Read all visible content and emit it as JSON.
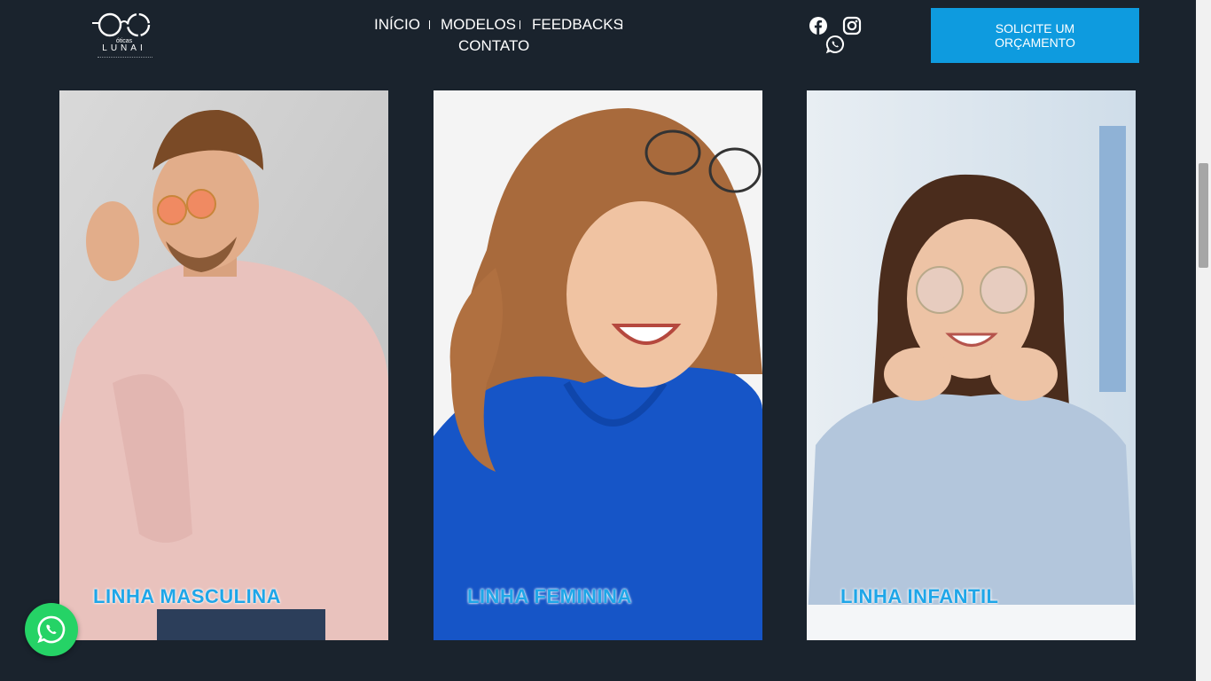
{
  "brand": {
    "subname": "óticas",
    "name": "LUNAI"
  },
  "nav": {
    "items": [
      {
        "label": "INÍCIO"
      },
      {
        "label": "MODELOS"
      },
      {
        "label": "FEEDBACKS"
      },
      {
        "label": "CONTATO"
      }
    ]
  },
  "social": {
    "icons": [
      "facebook-icon",
      "instagram-icon",
      "whatsapp-icon"
    ]
  },
  "cta": {
    "label": "SOLICITE UM ORÇAMENTO"
  },
  "cards": [
    {
      "label": "LINHA MASCULINA"
    },
    {
      "label": "LINHA FEMININA"
    },
    {
      "label": "LINHA INFANTIL"
    }
  ],
  "colors": {
    "background": "#1a232d",
    "accent": "#0e9bdf",
    "label": "#1fa6e8",
    "whatsapp": "#25d366"
  }
}
